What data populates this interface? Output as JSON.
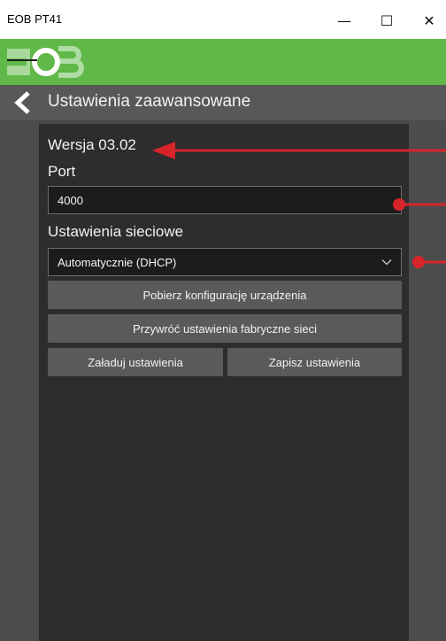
{
  "window": {
    "title": "EOB PT41",
    "minimize_glyph": "—",
    "maximize_glyph": "☐",
    "close_glyph": "✕"
  },
  "header": {
    "title": "Ustawienia zaawansowane",
    "back_icon": "chevron-left-icon"
  },
  "form": {
    "version_text": "Wersja 03.02",
    "port_label": "Port",
    "port_value": "4000",
    "network_label": "Ustawienia sieciowe",
    "network_selected": "Automatycznie (DHCP)"
  },
  "buttons": {
    "download_config": "Pobierz konfigurację urządzenia",
    "restore_factory": "Przywróć ustawienia fabryczne sieci",
    "load_settings": "Załaduj ustawienia",
    "save_settings": "Zapisz ustawienia"
  },
  "colors": {
    "brand_green": "#5fb848",
    "annotation_red": "#d7242a",
    "panel_dark": "#2d2d2d",
    "button_gray": "#5a5a5a"
  }
}
